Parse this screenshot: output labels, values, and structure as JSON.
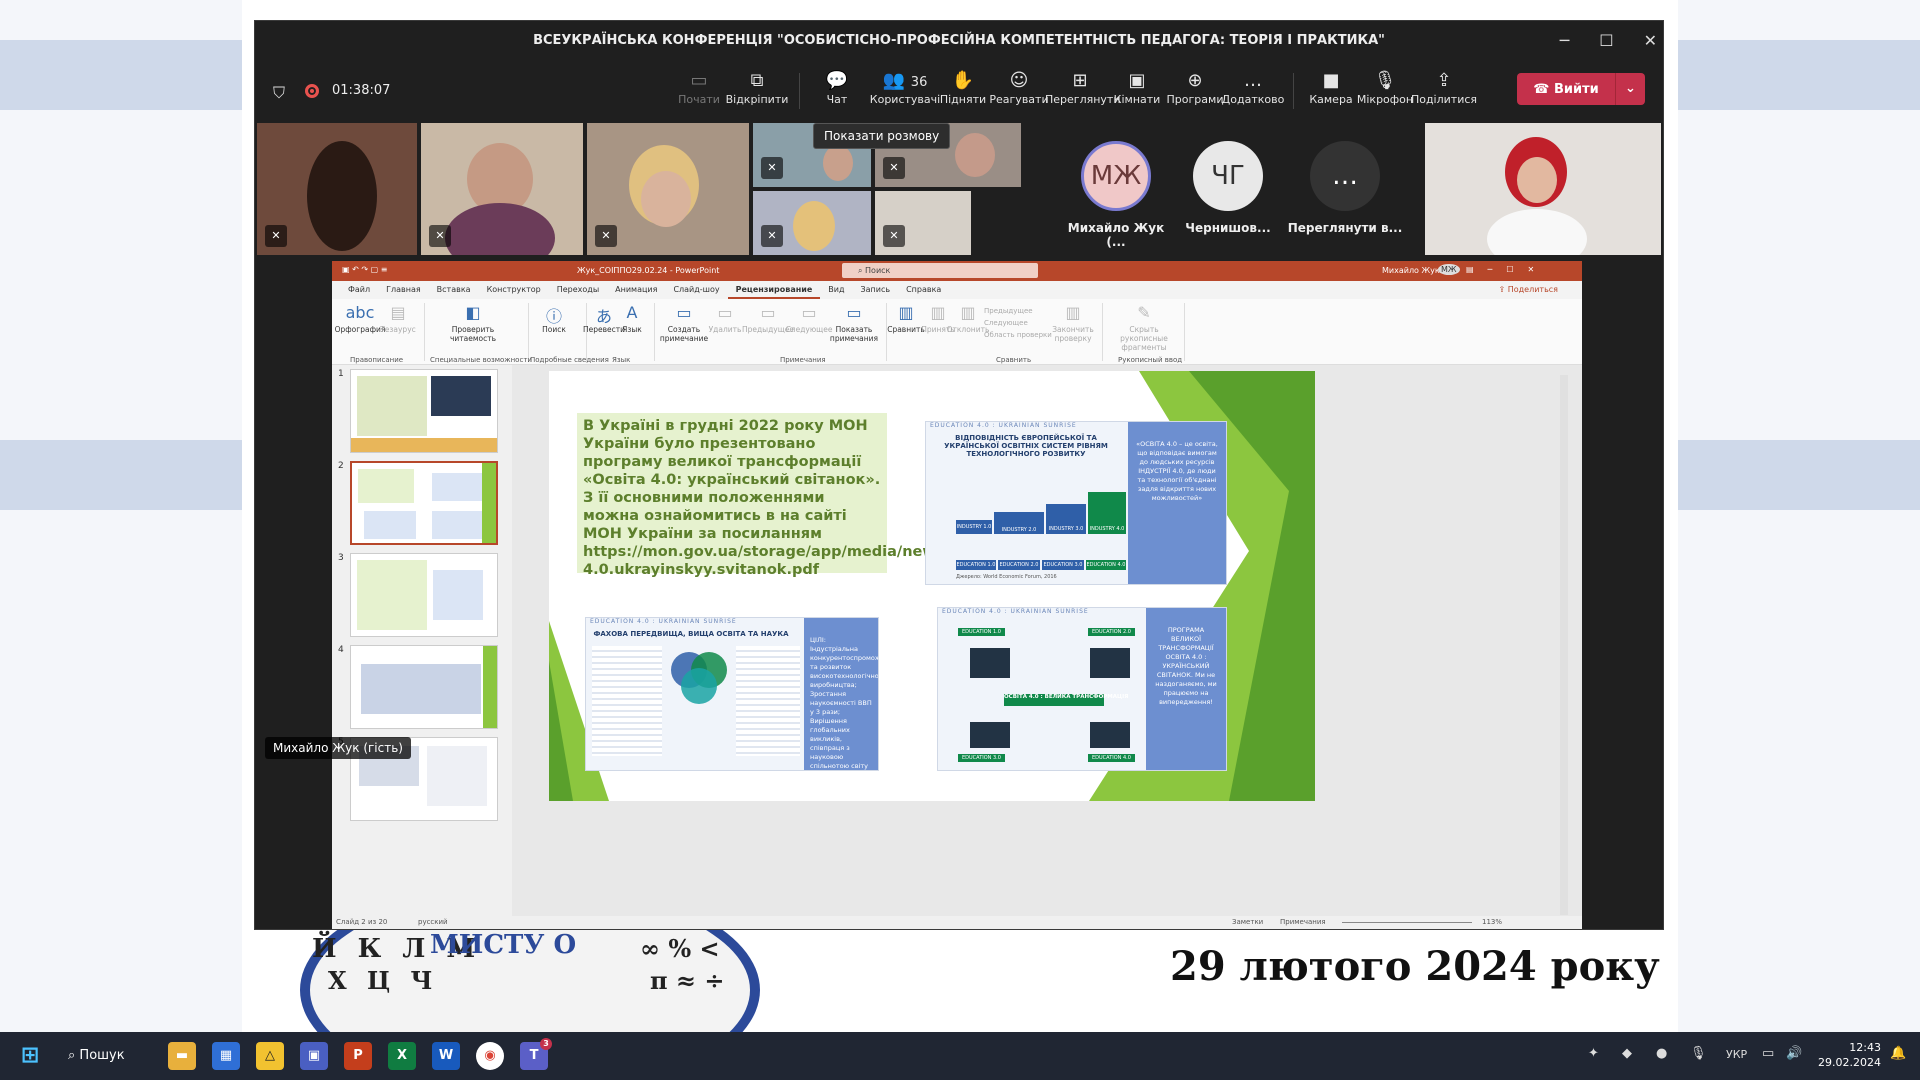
{
  "meeting": {
    "title": "ВСЕУКРАЇНСЬКА КОНФЕРЕНЦІЯ \"ОСОБИСТІСНО-ПРОФЕСІЙНА КОМПЕТЕНТНІСТЬ ПЕДАГОГА: ТЕОРІЯ І ПРАКТИКА\"",
    "timer": "01:38:07",
    "toolbar": [
      {
        "label": "Почати",
        "icon": "▭"
      },
      {
        "label": "Відкріпити",
        "icon": "⧉"
      },
      {
        "label": "Чат",
        "icon": "💬"
      },
      {
        "label": "Користувачі",
        "icon": "👥",
        "count": "36"
      },
      {
        "label": "Підняти",
        "icon": "✋"
      },
      {
        "label": "Реагувати",
        "icon": "☺"
      },
      {
        "label": "Переглянути",
        "icon": "⊞"
      },
      {
        "label": "Кімнати",
        "icon": "▣"
      },
      {
        "label": "Програми",
        "icon": "⊕"
      },
      {
        "label": "Додатково",
        "icon": "…"
      },
      {
        "label": "Камера",
        "icon": "■"
      },
      {
        "label": "Мікрофон",
        "icon": "🎙"
      },
      {
        "label": "Поділитися",
        "icon": "⇪"
      }
    ],
    "leave_label": "Вийти",
    "tooltip": "Показати розмову",
    "participants": [
      {
        "initials": "МЖ",
        "name": "Михайло Жук (..."
      },
      {
        "initials": "ЧГ",
        "name": "Чернишов..."
      },
      {
        "initials": "…",
        "name": "Переглянути в..."
      }
    ],
    "presenter_caption": "Михайло Жук (гість)"
  },
  "ppt": {
    "title": "Жук_СОІППО29.02.24 - PowerPoint",
    "search": "Поиск",
    "user": "Михайло Жук",
    "user_initials": "МЖ",
    "tabs": [
      "Файл",
      "Главная",
      "Вставка",
      "Конструктор",
      "Переходы",
      "Анимация",
      "Слайд-шоу",
      "Рецензирование",
      "Вид",
      "Запись",
      "Справка"
    ],
    "active_tab": "Рецензирование",
    "share": "Поделиться",
    "ribbon": [
      {
        "label": "Орфография",
        "icon": "abc"
      },
      {
        "label": "Тезаурус",
        "icon": "▤"
      },
      {
        "label": "Проверить читаемость",
        "icon": "◧"
      },
      {
        "label": "Поиск",
        "icon": "ⓘ"
      },
      {
        "label": "Перевести",
        "icon": "あ"
      },
      {
        "label": "Язык",
        "icon": "A"
      },
      {
        "label": "Создать примечание",
        "icon": "▭"
      },
      {
        "label": "Удалить",
        "icon": "▭"
      },
      {
        "label": "Предыдущее",
        "icon": "▭"
      },
      {
        "label": "Следующее",
        "icon": "▭"
      },
      {
        "label": "Показать примечания",
        "icon": "▭"
      },
      {
        "label": "Сравнить",
        "icon": "▥"
      },
      {
        "label": "Принять",
        "icon": "▥"
      },
      {
        "label": "Отклонить",
        "icon": "▥"
      },
      {
        "label": "Закончить проверку",
        "icon": "▥"
      },
      {
        "label": "Скрыть рукописные фрагменты",
        "icon": "✎"
      }
    ],
    "ribbon_small": [
      "Предыдущее",
      "Следующее",
      "Область проверки"
    ],
    "groups": [
      "Правописание",
      "Специальные возможности",
      "Подробные сведения",
      "Язык",
      "Примечания",
      "Сравнить",
      "Рукописный ввод"
    ],
    "slide_numbers": [
      "1",
      "2",
      "3",
      "4",
      "5"
    ],
    "slide_text": "В Україні в грудні 2022 року МОН України було презентовано програму великої трансформації «Освіта 4.0: український світанок». З її основними положеннями можна ознайомитись в на сайті МОН України за посиланням https://mon.gov.ua/storage/app/media/news/2022/12/10/Osvita-4.0.ukrayinskyy.svitanok.pdf",
    "img1": {
      "title": "ВІДПОВІДНІСТЬ ЄВРОПЕЙСЬКОЇ ТА УКРАЇНСЬКОЇ ОСВІТНІХ СИСТЕМ РІВНЯМ ТЕХНОЛОГІЧНОГО РОЗВИТКУ",
      "side": "«ОСВІТА 4.0 – це освіта, що відповідає вимогам до людських ресурсів ІНДУСТРІЇ 4.0, де люди та технології об'єднані задля відкриття нових можливостей»",
      "bars_industry": [
        "INDUSTRY 1.0",
        "INDUSTRY 2.0",
        "INDUSTRY 3.0",
        "INDUSTRY 4.0"
      ],
      "bars_education": [
        "EDUCATION 1.0",
        "EDUCATION 2.0",
        "EDUCATION 3.0",
        "EDUCATION 4.0"
      ],
      "source": "Джерело: World Economic Forum, 2016"
    },
    "img2": {
      "title": "ФАХОВА ПЕРЕДВИЩА, ВИЩА ОСВІТА ТА НАУКА",
      "side": "ЦІЛІ: Індустріальна конкурентоспроможність та розвиток високотехнологічного виробництва; Зростання наукоємності ВВП у 3 рази; Вирішення глобальних викликів, співпраця з науковою спільнотою світу"
    },
    "img3": {
      "title": "ОСВІТА 4.0 : ВЕЛИКА ТРАНСФОРМАЦІЯ",
      "side": "ПРОГРАМА ВЕЛИКОЇ ТРАНСФОРМАЦІЇ ОСВІТА 4.0 : УКРАЇНСЬКИЙ СВІТАНОК. Ми не наздоганяємо, ми працюємо на випередження!",
      "labels": [
        "EDUCATION 1.0",
        "EDUCATION 2.0",
        "EDUCATION 3.0",
        "EDUCATION 4.0"
      ]
    },
    "img_header": "EDUCATION 4.0 : UKRAINIAN SUNRISE",
    "status_left": "Слайд 2 из 20",
    "status_lang": "русский",
    "status_notes": "Заметки",
    "status_comments": "Примечания",
    "zoom": "113%"
  },
  "desktop": {
    "date_text": "29 лютого 2024 року",
    "logo_letters_1": "Й К Л М",
    "logo_letters_2": "Х Ц Ч",
    "logo_letters_3": "∞ % <",
    "logo_letters_4": "π ≈ ÷",
    "logo_arc": "МИСТУ О"
  },
  "taskbar": {
    "search": "Пошук",
    "lang": "УКР",
    "time": "12:43",
    "date": "29.02.2024",
    "teams_badge": "3"
  },
  "colors": {
    "leave": "#c4314b",
    "ppt_accent": "#b7472a",
    "slide_green": "#8cc63f",
    "slide_text": "#5d7f2c",
    "taskbar": "#202633"
  }
}
